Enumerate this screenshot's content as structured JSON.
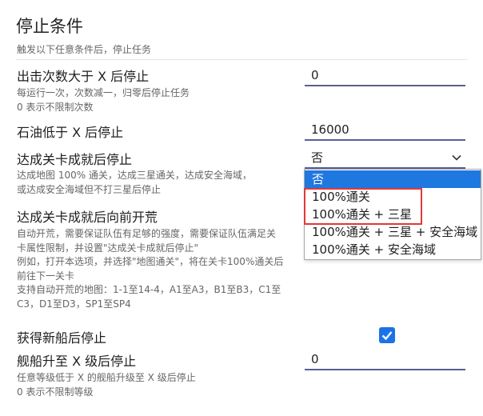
{
  "header": {
    "title": "停止条件",
    "subtitle": "触发以下任意条件后，停止任务"
  },
  "settings": [
    {
      "title": "出击次数大于 X 后停止",
      "help": [
        "每运行一次，次数减一，归零后停止任务",
        "0 表示不限制次数"
      ],
      "value": "0"
    },
    {
      "title": "石油低于 X 后停止",
      "value": "16000"
    },
    {
      "title": "达成关卡成就后停止",
      "help": [
        "达成地图 100% 通关，达成三星通关，达成安全海域，",
        "或达成安全海域但不打三星后停止"
      ],
      "selected": "否"
    },
    {
      "title": "达成关卡成就后向前开荒",
      "help": [
        "自动开荒，需要保证队伍有足够的强度，需要保证队伍满足关",
        "卡属性限制，并设置\"达成关卡成就后停止\"",
        "例如，打开本选项，并选择\"地图通关\"，将在关卡100%通关后",
        "前往下一关卡",
        "支持自动开荒的地图：1-1至14-4，A1至A3，B1至B3，C1至",
        "C3，D1至D3，SP1至SP4"
      ]
    },
    {
      "title": "获得新船后停止",
      "checked": true
    },
    {
      "title": "舰船升至 X 级后停止",
      "help": [
        "任意等级低于 X 的舰船升级至 X 级后停止",
        "0 表示不限制等级"
      ],
      "value": "0"
    }
  ],
  "dropdown": {
    "options": [
      "否",
      "100%通关",
      "100%通关 + 三星",
      "100%通关 + 三星 + 安全海域",
      "100%通关 + 安全海域"
    ]
  },
  "icons": {
    "chevron": "chevron-down-icon",
    "check": "checkmark-icon"
  },
  "colors": {
    "accent": "#1e78e0",
    "underline": "#5a5e96",
    "highlight": "#e0393a"
  }
}
